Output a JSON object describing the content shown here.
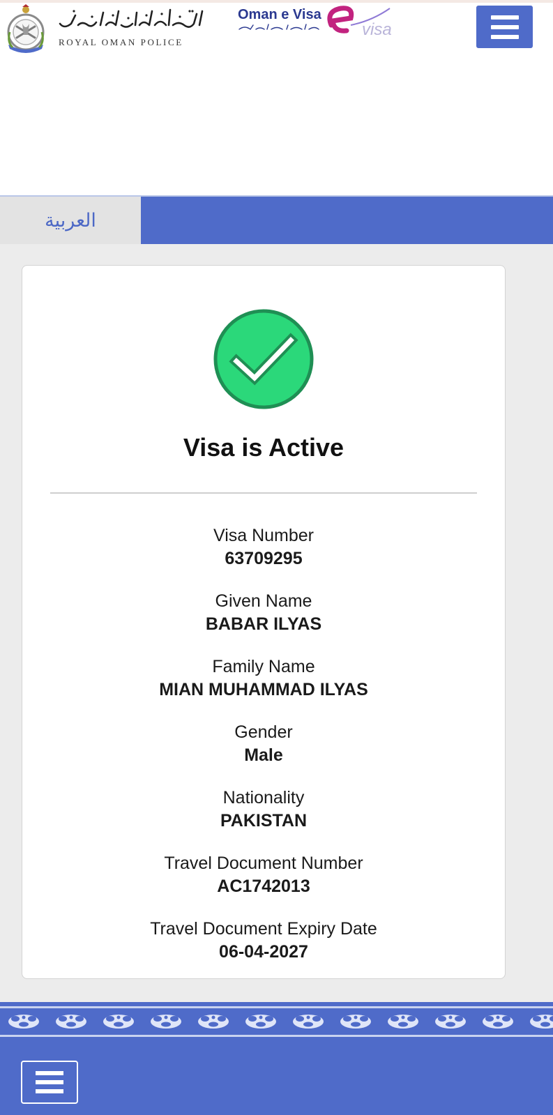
{
  "header": {
    "org_name_arabic": "شرطة عمان السلطانية",
    "org_name": "ROYAL OMAN POLICE",
    "evisa_title": "Oman e Visa",
    "evisa_subtitle_arabic": "التأشيرة الإلكترونية العمانية",
    "evisa_logo_text": "visa",
    "menu_icon": "hamburger-menu-icon"
  },
  "nav": {
    "language_link": "العربية"
  },
  "result": {
    "status_icon": "check-circle-icon",
    "status_title": "Visa is Active",
    "fields": [
      {
        "label": "Visa Number",
        "value": "63709295"
      },
      {
        "label": "Given Name",
        "value": "BABAR ILYAS"
      },
      {
        "label": "Family Name",
        "value": "MIAN MUHAMMAD ILYAS"
      },
      {
        "label": "Gender",
        "value": "Male"
      },
      {
        "label": "Nationality",
        "value": "PAKISTAN"
      },
      {
        "label": "Travel Document Number",
        "value": "AC1742013"
      },
      {
        "label": "Travel Document Expiry Date",
        "value": "06-04-2027"
      }
    ]
  },
  "footer": {
    "menu_icon": "hamburger-menu-icon"
  },
  "colors": {
    "brand_blue": "#4f6bc9",
    "success_green": "#2bd87a",
    "success_green_border": "#1f8f54",
    "evisa_navy": "#2b3990",
    "evisa_magenta": "#c2237f"
  }
}
